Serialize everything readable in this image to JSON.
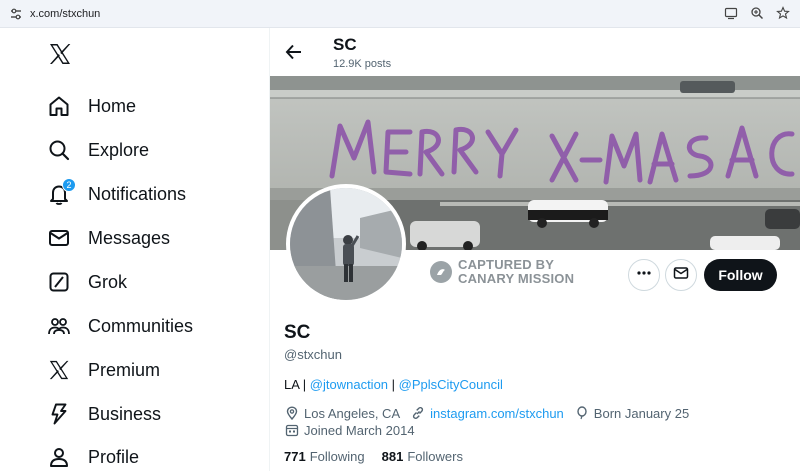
{
  "browser": {
    "url": "x.com/stxchun",
    "icons": [
      "site-info-icon",
      "cast-icon",
      "zoom-icon",
      "bookmark-star-icon"
    ]
  },
  "sidebar": {
    "logo": "x-logo-icon",
    "items": [
      {
        "label": "Home",
        "icon": "home-icon"
      },
      {
        "label": "Explore",
        "icon": "search-icon"
      },
      {
        "label": "Notifications",
        "icon": "bell-icon",
        "badge": "2"
      },
      {
        "label": "Messages",
        "icon": "envelope-icon"
      },
      {
        "label": "Grok",
        "icon": "grok-icon"
      },
      {
        "label": "Communities",
        "icon": "people-icon"
      },
      {
        "label": "Premium",
        "icon": "x-logo-icon"
      },
      {
        "label": "Business",
        "icon": "lightning-icon"
      },
      {
        "label": "Profile",
        "icon": "person-icon"
      }
    ]
  },
  "header": {
    "name": "SC",
    "posts": "12.9K posts"
  },
  "banner": {
    "graffiti": "MERRY X-MAS ACAB"
  },
  "watermark": {
    "line1": "CAPTURED BY",
    "line2": "CANARY MISSION"
  },
  "actions": {
    "follow_label": "Follow"
  },
  "profile": {
    "name": "SC",
    "handle": "@stxchun",
    "bio_prefix": "LA | ",
    "bio_link1": "@jtownaction",
    "bio_sep": " | ",
    "bio_link2": "@PplsCityCouncil",
    "location": "Los Angeles, CA",
    "website": "instagram.com/stxchun",
    "birthday": "Born January 25",
    "joined": "Joined March 2014",
    "following_count": "771",
    "following_label": "Following",
    "followers_count": "881",
    "followers_label": "Followers"
  },
  "colors": {
    "accent": "#1d9bf0",
    "text": "#0f1419",
    "muted": "#536471",
    "graffiti": "#8a4fa8"
  }
}
